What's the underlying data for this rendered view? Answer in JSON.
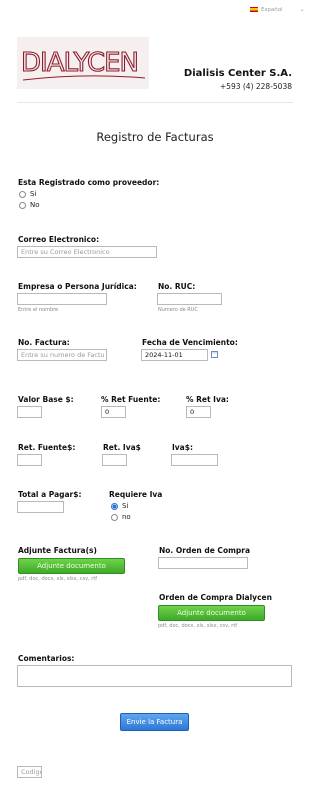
{
  "language": {
    "flag": "es-flag-icon",
    "label": "Español"
  },
  "company": {
    "logo_text": "DIALYCEN",
    "name": "Dialisis Center S.A.",
    "phone": "+593 (4) 228-5038"
  },
  "form": {
    "title": "Registro de Facturas",
    "provider": {
      "label": "Esta Registrado como proveedor:",
      "options": [
        "Si",
        "No"
      ]
    },
    "email": {
      "label": "Correo Electronico:",
      "placeholder": "Entre su Correo Electronico"
    },
    "company": {
      "label": "Empresa o Persona Jurídica:",
      "helper": "Entre el nombre"
    },
    "ruc": {
      "label": "No. RUC:",
      "helper": "Numero de RUC"
    },
    "invoice_no": {
      "label": "No. Factura:",
      "placeholder": "Entre su numero de Factu"
    },
    "due_date": {
      "label": "Fecha de Vencimiento:",
      "value": "2024-11-01"
    },
    "base_value": {
      "label": "Valor Base $:",
      "value": ""
    },
    "ret_fuente_pct": {
      "label": "% Ret Fuente:",
      "value": "0"
    },
    "ret_iva_pct": {
      "label": "% Ret Iva:",
      "value": "0"
    },
    "ret_fuente": {
      "label": "Ret. Fuente$:"
    },
    "ret_iva": {
      "label": "Ret. Iva$"
    },
    "iva": {
      "label": "Iva$:"
    },
    "total": {
      "label": "Total a Pagar$:"
    },
    "requires_iva": {
      "label": "Requiere Iva",
      "options": [
        "Si",
        "no"
      ],
      "selected": "Si"
    },
    "attach_invoice": {
      "label": "Adjunte Factura(s)",
      "button": "Adjunte documento",
      "helper": "pdf, doc, docx, xls, xlsx, csv, rtf"
    },
    "po_number": {
      "label": "No. Orden de Compra"
    },
    "po_dialycen": {
      "label": "Orden de Compra Dialycen",
      "button": "Adjunte documento",
      "helper": "pdf, doc, docx, xls, xlsx, csv, rtf"
    },
    "comments": {
      "label": "Comentarios:"
    },
    "submit": "Envie la Factura",
    "code_placeholder": "Codigo"
  }
}
